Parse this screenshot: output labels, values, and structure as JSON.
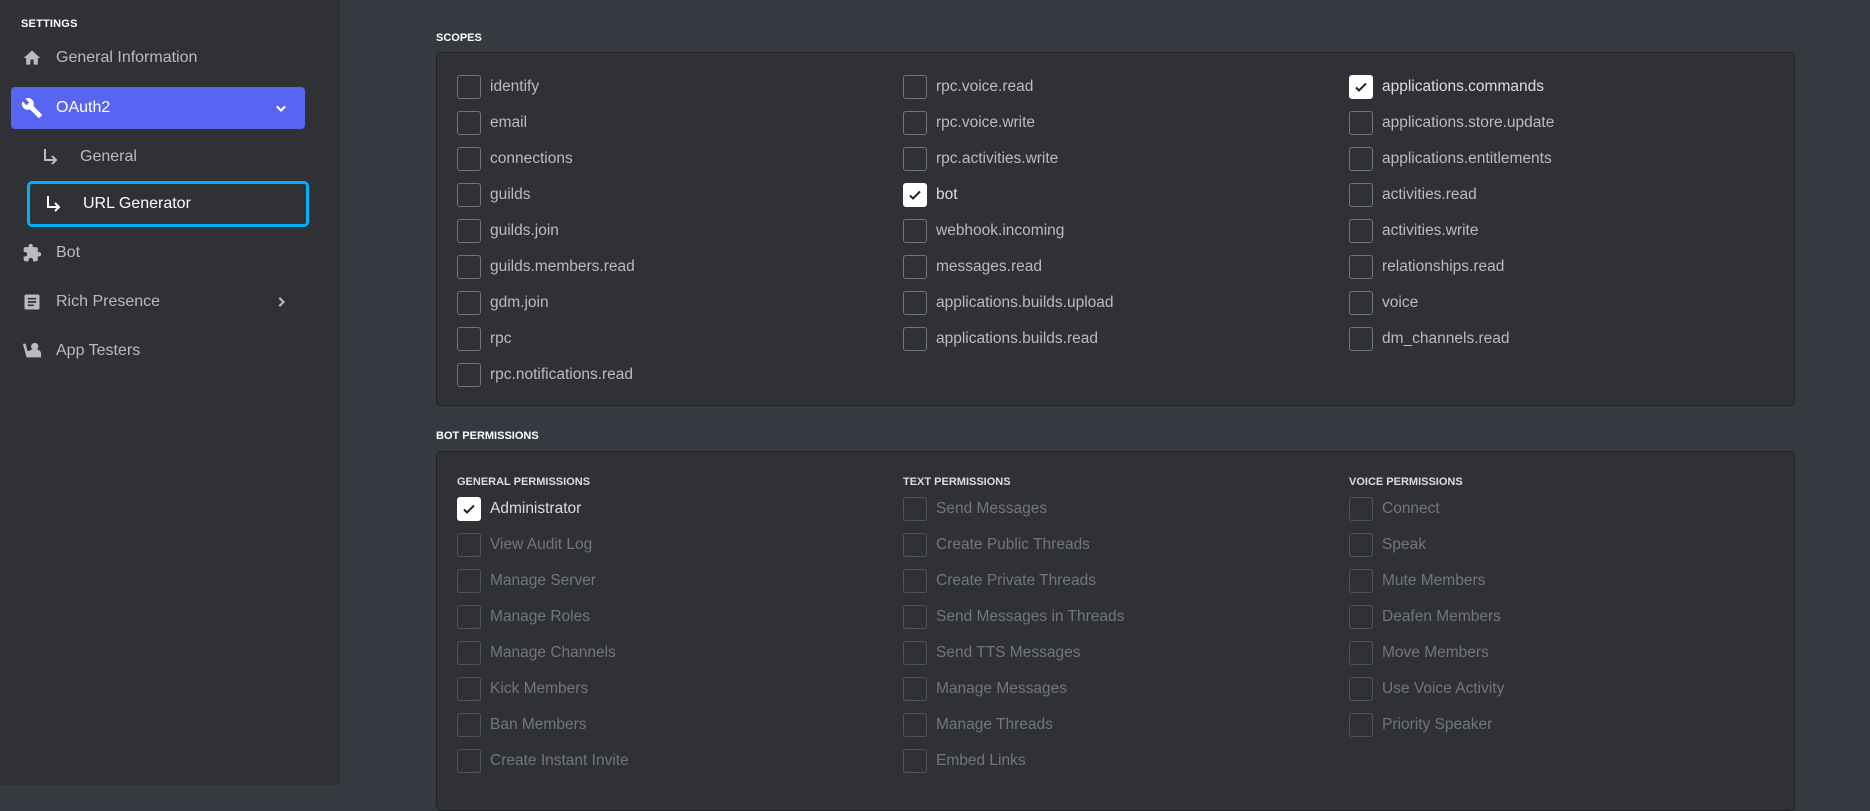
{
  "sidebar": {
    "heading": "SETTINGS",
    "items": [
      {
        "label": "General Information",
        "icon": "home-icon"
      },
      {
        "label": "OAuth2",
        "icon": "wrench-icon",
        "active": true,
        "chevron": "chevron-down-icon"
      },
      {
        "label": "General",
        "sub": true
      },
      {
        "label": "URL Generator",
        "sub": true,
        "selected": true
      },
      {
        "label": "Bot",
        "icon": "puzzle-icon"
      },
      {
        "label": "Rich Presence",
        "icon": "document-icon",
        "chevron": "chevron-right-icon"
      },
      {
        "label": "App Testers",
        "icon": "testers-icon"
      }
    ]
  },
  "scopes": {
    "label": "SCOPES",
    "columns": [
      [
        {
          "label": "identify",
          "checked": false
        },
        {
          "label": "email",
          "checked": false
        },
        {
          "label": "connections",
          "checked": false
        },
        {
          "label": "guilds",
          "checked": false
        },
        {
          "label": "guilds.join",
          "checked": false
        },
        {
          "label": "guilds.members.read",
          "checked": false
        },
        {
          "label": "gdm.join",
          "checked": false
        },
        {
          "label": "rpc",
          "checked": false
        },
        {
          "label": "rpc.notifications.read",
          "checked": false
        }
      ],
      [
        {
          "label": "rpc.voice.read",
          "checked": false
        },
        {
          "label": "rpc.voice.write",
          "checked": false
        },
        {
          "label": "rpc.activities.write",
          "checked": false
        },
        {
          "label": "bot",
          "checked": true
        },
        {
          "label": "webhook.incoming",
          "checked": false
        },
        {
          "label": "messages.read",
          "checked": false
        },
        {
          "label": "applications.builds.upload",
          "checked": false
        },
        {
          "label": "applications.builds.read",
          "checked": false
        }
      ],
      [
        {
          "label": "applications.commands",
          "checked": true
        },
        {
          "label": "applications.store.update",
          "checked": false
        },
        {
          "label": "applications.entitlements",
          "checked": false
        },
        {
          "label": "activities.read",
          "checked": false
        },
        {
          "label": "activities.write",
          "checked": false
        },
        {
          "label": "relationships.read",
          "checked": false
        },
        {
          "label": "voice",
          "checked": false
        },
        {
          "label": "dm_channels.read",
          "checked": false
        }
      ]
    ]
  },
  "bot_permissions": {
    "label": "BOT PERMISSIONS",
    "columns": [
      {
        "heading": "GENERAL PERMISSIONS",
        "items": [
          {
            "label": "Administrator",
            "checked": true
          },
          {
            "label": "View Audit Log",
            "disabled": true
          },
          {
            "label": "Manage Server",
            "disabled": true
          },
          {
            "label": "Manage Roles",
            "disabled": true
          },
          {
            "label": "Manage Channels",
            "disabled": true
          },
          {
            "label": "Kick Members",
            "disabled": true
          },
          {
            "label": "Ban Members",
            "disabled": true
          },
          {
            "label": "Create Instant Invite",
            "disabled": true
          }
        ]
      },
      {
        "heading": "TEXT PERMISSIONS",
        "items": [
          {
            "label": "Send Messages",
            "disabled": true
          },
          {
            "label": "Create Public Threads",
            "disabled": true
          },
          {
            "label": "Create Private Threads",
            "disabled": true
          },
          {
            "label": "Send Messages in Threads",
            "disabled": true
          },
          {
            "label": "Send TTS Messages",
            "disabled": true
          },
          {
            "label": "Manage Messages",
            "disabled": true
          },
          {
            "label": "Manage Threads",
            "disabled": true
          },
          {
            "label": "Embed Links",
            "disabled": true
          }
        ]
      },
      {
        "heading": "VOICE PERMISSIONS",
        "items": [
          {
            "label": "Connect",
            "disabled": true
          },
          {
            "label": "Speak",
            "disabled": true
          },
          {
            "label": "Mute Members",
            "disabled": true
          },
          {
            "label": "Deafen Members",
            "disabled": true
          },
          {
            "label": "Move Members",
            "disabled": true
          },
          {
            "label": "Use Voice Activity",
            "disabled": true
          },
          {
            "label": "Priority Speaker",
            "disabled": true
          }
        ]
      }
    ]
  }
}
